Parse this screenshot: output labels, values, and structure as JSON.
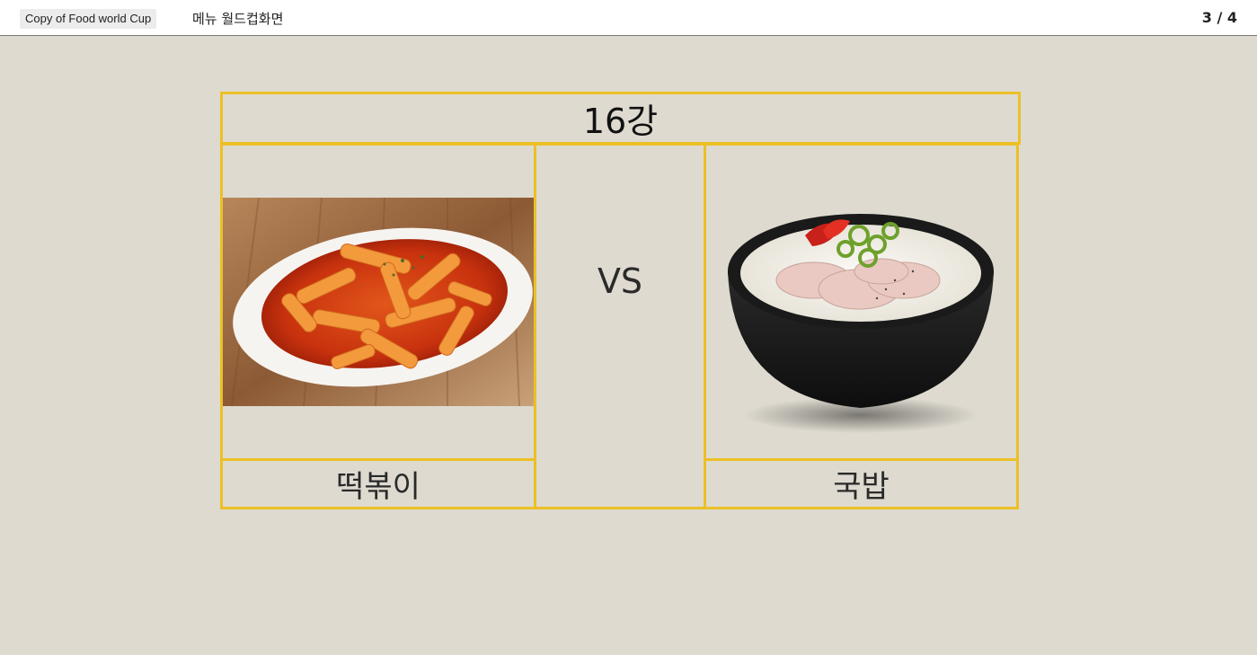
{
  "topbar": {
    "project_tag": "Copy of Food world Cup",
    "page_name": "메뉴 월드컵화면",
    "page_counter": "3 / 4"
  },
  "match": {
    "round": "16강",
    "vs_label": "VS",
    "left_food": {
      "name": "떡볶이",
      "image": "tteokbokki-photo"
    },
    "right_food": {
      "name": "국밥",
      "image": "gukbap-photo"
    }
  },
  "colors": {
    "background": "#dedad0",
    "frame_border": "#ecc025",
    "topbar": "#ffffff"
  }
}
